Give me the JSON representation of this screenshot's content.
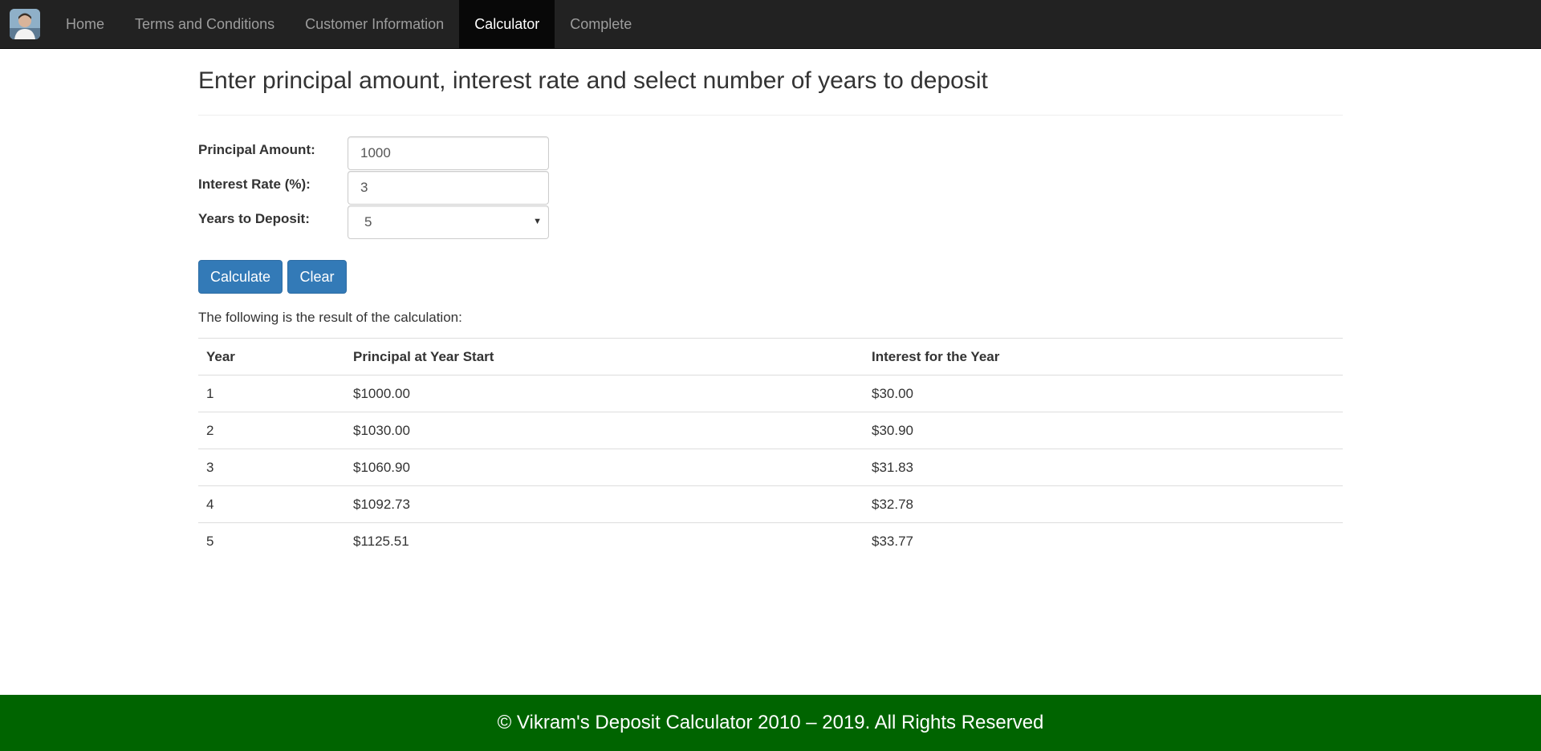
{
  "nav": {
    "logo_icon": "user-avatar-icon",
    "items": [
      {
        "label": "Home",
        "active": false
      },
      {
        "label": "Terms and Conditions",
        "active": false
      },
      {
        "label": "Customer Information",
        "active": false
      },
      {
        "label": "Calculator",
        "active": true
      },
      {
        "label": "Complete",
        "active": false
      }
    ]
  },
  "page": {
    "title": "Enter principal amount, interest rate and select number of years to deposit"
  },
  "form": {
    "principal": {
      "label": "Principal Amount:",
      "value": "1000"
    },
    "interest": {
      "label": "Interest Rate (%):",
      "value": "3"
    },
    "years": {
      "label": "Years to Deposit:",
      "selected": "5"
    },
    "calculate_label": "Calculate",
    "clear_label": "Clear"
  },
  "results": {
    "intro": "The following is the result of the calculation:",
    "headers": [
      "Year",
      "Principal at Year Start",
      "Interest for the Year"
    ],
    "rows": [
      [
        "1",
        "$1000.00",
        "$30.00"
      ],
      [
        "2",
        "$1030.00",
        "$30.90"
      ],
      [
        "3",
        "$1060.90",
        "$31.83"
      ],
      [
        "4",
        "$1092.73",
        "$32.78"
      ],
      [
        "5",
        "$1125.51",
        "$33.77"
      ]
    ]
  },
  "footer": {
    "text": "© Vikram's Deposit Calculator 2010 – 2019. All Rights Reserved"
  },
  "colors": {
    "navbar": "#222222",
    "nav_active": "#080808",
    "button": "#337ab7",
    "footer": "#006400"
  }
}
